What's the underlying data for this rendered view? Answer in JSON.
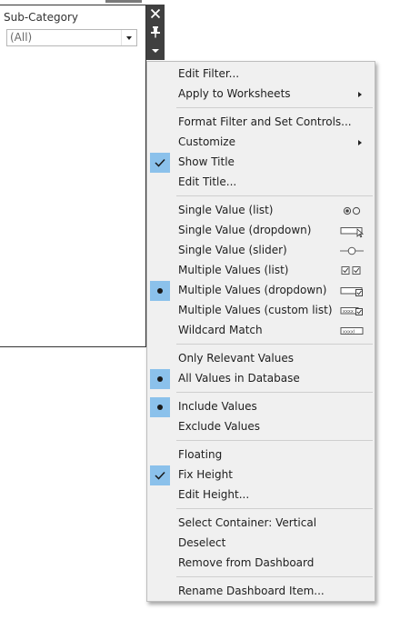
{
  "filter": {
    "title": "Sub-Category",
    "value": "(All)"
  },
  "toolbar": {
    "close_icon": "close-icon",
    "pin_icon": "pin-icon",
    "more_icon": "chevron-down-icon"
  },
  "menu": {
    "edit_filter": "Edit Filter...",
    "apply_to_worksheets": "Apply to Worksheets",
    "format_filter": "Format Filter and Set Controls...",
    "customize": "Customize",
    "show_title": "Show Title",
    "edit_title": "Edit Title...",
    "single_value_list": "Single Value (list)",
    "single_value_dropdown": "Single Value (dropdown)",
    "single_value_slider": "Single Value (slider)",
    "multiple_values_list": "Multiple Values (list)",
    "multiple_values_dropdown": "Multiple Values (dropdown)",
    "multiple_values_custom": "Multiple Values (custom list)",
    "wildcard_match": "Wildcard Match",
    "only_relevant": "Only Relevant Values",
    "all_values": "All Values in Database",
    "include_values": "Include Values",
    "exclude_values": "Exclude Values",
    "floating": "Floating",
    "fix_height": "Fix Height",
    "edit_height": "Edit Height...",
    "select_container": "Select Container: Vertical",
    "deselect": "Deselect",
    "remove": "Remove from Dashboard",
    "rename": "Rename Dashboard Item..."
  },
  "colors": {
    "selected_mark_bg": "#8bc1eb",
    "menu_bg": "#f0f0f0",
    "toolbar_bg": "#404040"
  }
}
